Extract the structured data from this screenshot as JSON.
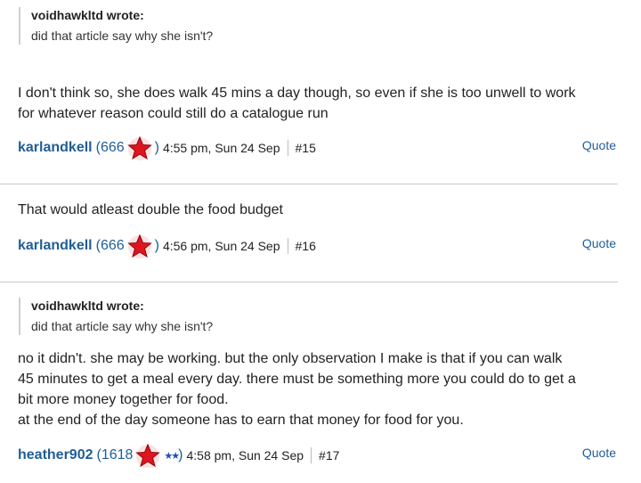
{
  "posts": [
    {
      "quote": {
        "author": "voidhawkltd wrote:",
        "text": "did that article say why she isn't?"
      },
      "body": [
        "I don't think so, she does walk 45 mins a day though, so even if she is too unwell to work",
        "for whatever reason could still do a catalogue run"
      ],
      "username": "karlandkell",
      "rep": "(666",
      "rep_close": ")",
      "time": "4:55 pm, Sun 24 Sep",
      "number": "#15",
      "quote_label": "Quote"
    },
    {
      "body": [
        "That would atleast double the food budget"
      ],
      "username": "karlandkell",
      "rep": "(666",
      "rep_close": ")",
      "time": "4:56 pm, Sun 24 Sep",
      "number": "#16",
      "quote_label": "Quote"
    },
    {
      "quote": {
        "author": "voidhawkltd wrote:",
        "text": "did that article say why she isn't?"
      },
      "body": [
        "no it didn't. she may be working. but the only observation I make is that if you can walk",
        "45 minutes to get a meal every day. there must be something more you could do to get a",
        "bit more money together for food.",
        "at the end of the day someone has to earn that money for food for you."
      ],
      "username": "heather902",
      "rep": "(1618",
      "rep_close": ")",
      "stars": "★★",
      "time": "4:58 pm, Sun 24 Sep",
      "number": "#17",
      "quote_label": "Quote"
    }
  ],
  "colors": {
    "link": "#1f5e96",
    "badge_red": "#e0141e",
    "star_blue": "#1e4fb0"
  }
}
